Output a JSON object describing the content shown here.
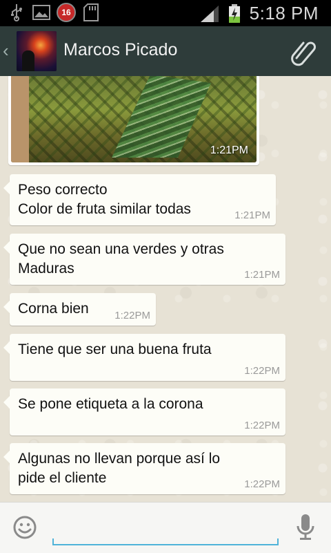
{
  "status_bar": {
    "time": "5:18 PM",
    "notification_count": "16",
    "icons": [
      "usb-icon",
      "image-icon",
      "notification-badge",
      "sd-card-icon",
      "signal-icon",
      "battery-charging-icon"
    ]
  },
  "header": {
    "contact_name": "Marcos Picado",
    "back_icon": "chevron-left-icon",
    "attach_icon": "paperclip-icon"
  },
  "image_message": {
    "time": "1:21PM"
  },
  "messages": [
    {
      "text": "Peso correcto\nColor de fruta similar todas",
      "time": "1:21PM"
    },
    {
      "text": "Que no sean una verdes y otras\nMaduras",
      "time": "1:21PM"
    },
    {
      "text": "Corna bien",
      "time": "1:22PM"
    },
    {
      "text": "Tiene que ser una buena fruta",
      "time": "1:22PM"
    },
    {
      "text": "Se pone etiqueta a la corona",
      "time": "1:22PM"
    },
    {
      "text": "Algunas no llevan porque así lo\npide el cliente",
      "time": "1:22PM"
    }
  ],
  "input": {
    "value": "",
    "placeholder": ""
  },
  "colors": {
    "header_bg": "#2e3c3a",
    "bubble_bg": "#fdfdf7",
    "input_accent": "#4fb3d9",
    "chat_bg": "#e7e2d5"
  }
}
